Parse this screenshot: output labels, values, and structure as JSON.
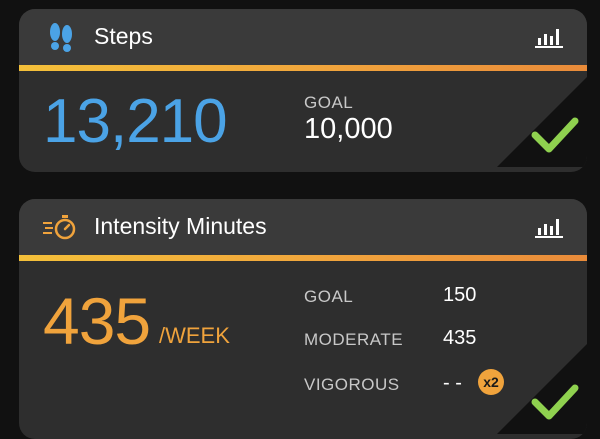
{
  "cards": {
    "steps": {
      "title": "Steps",
      "value": "13,210",
      "goal_label": "GOAL",
      "goal_value": "10,000",
      "icon": "footprints-icon",
      "chart_icon": "bar-chart-icon",
      "goal_met": true
    },
    "intensity": {
      "title": "Intensity Minutes",
      "value": "435",
      "unit": "/WEEK",
      "rows": [
        {
          "label": "GOAL",
          "value": "150"
        },
        {
          "label": "MODERATE",
          "value": "435"
        },
        {
          "label": "VIGOROUS",
          "value": "- -"
        }
      ],
      "vigorous_badge": "x2",
      "icon": "stopwatch-icon",
      "chart_icon": "bar-chart-icon",
      "goal_met": true
    }
  },
  "colors": {
    "steps_accent": "#4ba3e6",
    "intensity_accent": "#f0a33c",
    "divider": "#f0a43c",
    "check": "#8fd14f",
    "card_bg": "#2e2e2e",
    "header_bg": "#3a3a3a"
  }
}
